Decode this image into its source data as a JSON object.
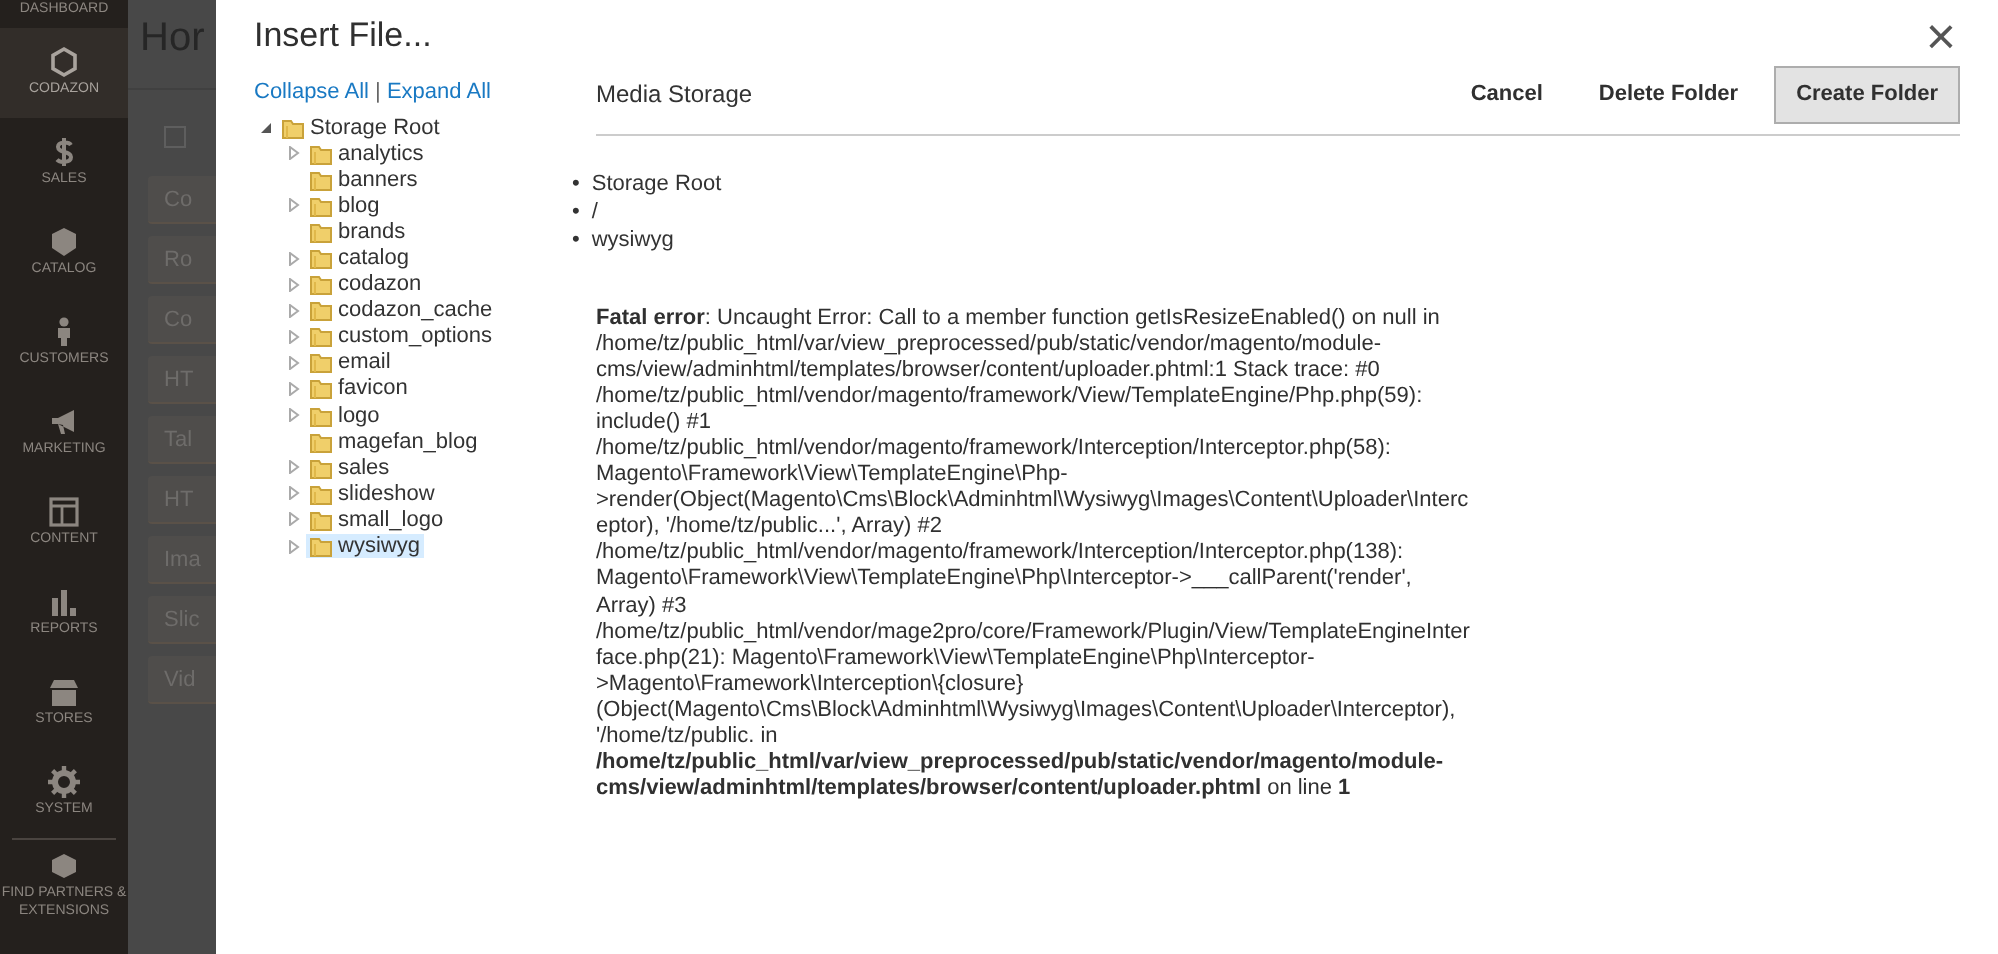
{
  "sidebar": {
    "items": [
      {
        "kind": "dashboard",
        "label": "DASHBOARD",
        "selected": false
      },
      {
        "kind": "codazon",
        "label": "CODAZON",
        "selected": true
      },
      {
        "kind": "sales",
        "label": "SALES",
        "selected": false
      },
      {
        "kind": "catalog",
        "label": "CATALOG",
        "selected": false
      },
      {
        "kind": "customers",
        "label": "CUSTOMERS",
        "selected": false
      },
      {
        "kind": "marketing",
        "label": "MARKETING",
        "selected": false
      },
      {
        "kind": "content",
        "label": "CONTENT",
        "selected": false
      },
      {
        "kind": "reports",
        "label": "REPORTS",
        "selected": false
      },
      {
        "kind": "stores",
        "label": "STORES",
        "selected": false
      },
      {
        "kind": "system",
        "label": "SYSTEM",
        "selected": false
      },
      {
        "kind": "partners",
        "label": "FIND PARTNERS & EXTENSIONS",
        "selected": false
      }
    ]
  },
  "background_page": {
    "title": "Hor",
    "checked": false,
    "buttons": [
      "Co",
      "Ro",
      "Co",
      "HT",
      "Tal",
      "HT",
      "Ima",
      "Slic",
      "Vid"
    ]
  },
  "dialog": {
    "title": "Insert File...",
    "close": "×",
    "tree_links": [
      "Collapse All",
      "Expand All"
    ],
    "tree_separator": "|",
    "tree": [
      {
        "label": "Storage Root",
        "expanded": true,
        "selected": false,
        "children": [
          {
            "label": "analytics",
            "expanded": false,
            "selected": false
          },
          {
            "label": "banners",
            "selected": false
          },
          {
            "label": "blog",
            "expanded": false,
            "selected": false
          },
          {
            "label": "brands",
            "selected": false
          },
          {
            "label": "catalog",
            "expanded": false,
            "selected": false
          },
          {
            "label": "codazon",
            "expanded": false,
            "selected": false
          },
          {
            "label": "codazon_cache",
            "expanded": false,
            "selected": false
          },
          {
            "label": "custom_options",
            "expanded": false,
            "selected": false
          },
          {
            "label": "email",
            "expanded": false,
            "selected": false
          },
          {
            "label": "favicon",
            "expanded": false,
            "selected": false
          },
          {
            "label": "logo",
            "expanded": false,
            "selected": false
          },
          {
            "label": "magefan_blog",
            "selected": false
          },
          {
            "label": "sales",
            "expanded": false,
            "selected": false
          },
          {
            "label": "slideshow",
            "expanded": false,
            "selected": false
          },
          {
            "label": "small_logo",
            "expanded": false,
            "selected": false
          },
          {
            "label": "wysiwyg",
            "expanded": false,
            "selected": true
          }
        ]
      }
    ],
    "section_title": "Media Storage",
    "actions": [
      {
        "label": "Cancel",
        "kind": "link"
      },
      {
        "label": "Delete Folder",
        "kind": "link"
      },
      {
        "label": "Create Folder",
        "kind": "button"
      }
    ],
    "breadcrumb_bullet": "•",
    "breadcrumbs": [
      "Storage Root",
      "/",
      "wysiwyg"
    ],
    "error": "**Fatal error**: Uncaught Error: Call to a member function getIsResizeEnabled() on null in /home/tz/public_html/var/view_preprocessed/pub/static/vendor/magento/module-cms/view/adminhtml/templates/browser/content/uploader.phtml:1 Stack trace: #0 /home/tz/public_html/vendor/magento/framework/View/TemplateEngine/Php.php(59): include() #1 /home/tz/public_html/vendor/magento/framework/Interception/Interceptor.php(58): Magento\\Framework\\View\\TemplateEngine\\Php->render(Object(Magento\\Cms\\Block\\Adminhtml\\Wysiwyg\\Images\\Content\\Uploader\\Interceptor), '/home/tz/public...', Array) #2 /home/tz/public_html/vendor/magento/framework/Interception/Interceptor.php(138): Magento\\Framework\\View\\TemplateEngine\\Php\\Interceptor->___callParent('render', Array) #3 /home/tz/public_html/vendor/mage2pro/core/Framework/Plugin/View/TemplateEngineInterface.php(21): Magento\\Framework\\View\\TemplateEngine\\Php\\Interceptor->Magento\\Framework\\Interception\\{closure}(Object(Magento\\Cms\\Block\\Adminhtml\\Wysiwyg\\Images\\Content\\Uploader\\Interceptor), '/home/tz/public. in **/home/tz/public_html/var/view_preprocessed/pub/static/vendor/magento/module-cms/view/adminhtml/templates/browser/content/uploader.phtml** on line **1**"
  }
}
